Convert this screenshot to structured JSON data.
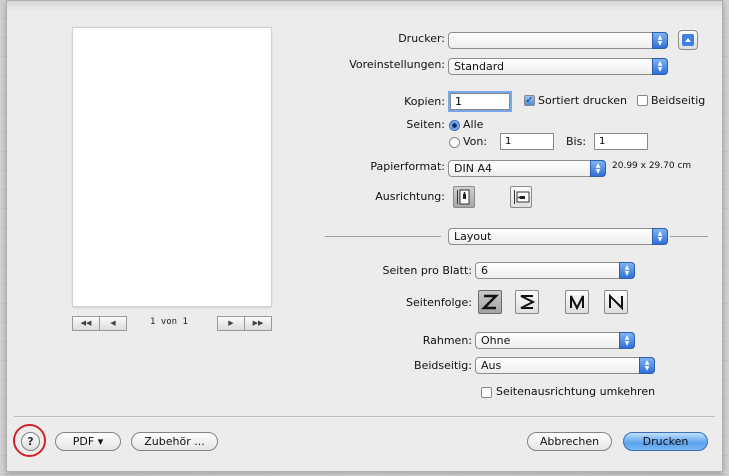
{
  "preview": {
    "page_counter": "1 von 1",
    "nav_first": "◀◀",
    "nav_prev": "◀",
    "nav_next": "▶",
    "nav_last": "▶▶"
  },
  "printer": {
    "label": "Drucker:",
    "value": ""
  },
  "presets": {
    "label": "Voreinstellungen:",
    "value": "Standard"
  },
  "copies": {
    "label": "Kopien:",
    "value": "1",
    "collate_label": "Sortiert drucken",
    "collate_checked": true,
    "duplex_label": "Beidseitig",
    "duplex_checked": false
  },
  "pages": {
    "label": "Seiten:",
    "all_label": "Alle",
    "range_label": "Von:",
    "from_value": "1",
    "to_label": "Bis:",
    "to_value": "1",
    "selected": "Alle"
  },
  "paper": {
    "label": "Papierformat:",
    "value": "DIN A4",
    "size_text": "20.99 x 29.70 cm"
  },
  "orientation": {
    "label": "Ausrichtung:",
    "selected": "portrait"
  },
  "section": {
    "value": "Layout"
  },
  "layout": {
    "pages_per_sheet_label": "Seiten pro Blatt:",
    "pages_per_sheet_value": "6",
    "page_order_label": "Seitenfolge:",
    "border_label": "Rahmen:",
    "border_value": "Ohne",
    "duplex_label": "Beidseitig:",
    "duplex_value": "Aus",
    "reverse_label": "Seitenausrichtung umkehren",
    "reverse_checked": false
  },
  "footer": {
    "help": "?",
    "pdf": "PDF ▾",
    "accessories": "Zubehör ...",
    "cancel": "Abbrechen",
    "print": "Drucken"
  },
  "colors": {
    "accent": "#3b82e6",
    "highlight_ring": "#d2232a"
  }
}
